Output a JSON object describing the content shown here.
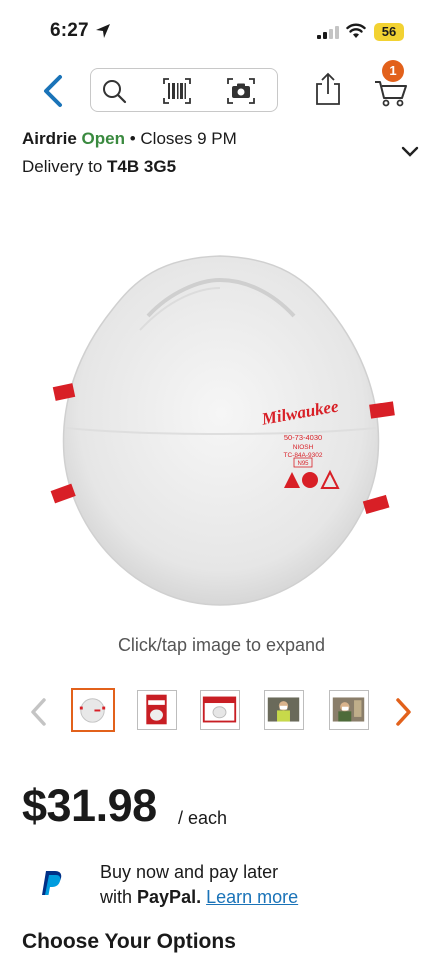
{
  "status_bar": {
    "time": "6:27",
    "battery": "56"
  },
  "header": {
    "cart_count": "1"
  },
  "store": {
    "name": "Airdrie",
    "status": "Open",
    "separator": "•",
    "closes": "Closes 9 PM",
    "delivery_label": "Delivery to",
    "postal_code": "T4B 3G5"
  },
  "product_image": {
    "brand": "Milwaukee",
    "part_no": "50-73-4030",
    "cert_1": "NIOSH",
    "cert_2": "TC-84A-9302",
    "rating": "N95",
    "expand_hint": "Click/tap image to expand"
  },
  "thumbnails": [
    {
      "name": "thumb-mask-front",
      "active": true
    },
    {
      "name": "thumb-package",
      "active": false
    },
    {
      "name": "thumb-box",
      "active": false
    },
    {
      "name": "thumb-worker-1",
      "active": false
    },
    {
      "name": "thumb-worker-2",
      "active": false
    }
  ],
  "price": {
    "amount": "$31.98",
    "unit": "/ each"
  },
  "paypal": {
    "line1": "Buy now and pay later",
    "line2_prefix": "with",
    "brand": "PayPal.",
    "link": "Learn more"
  },
  "options_heading": "Choose Your Options",
  "colors": {
    "accent": "#e2611b",
    "open": "#3a8a3f",
    "link": "#1a73b8",
    "back": "#1a73b8"
  }
}
